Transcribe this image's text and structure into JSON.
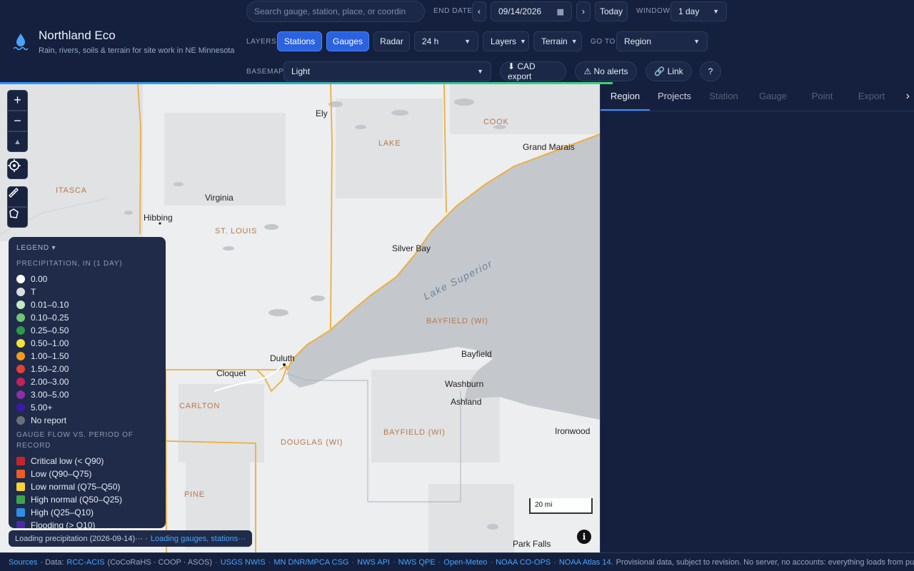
{
  "brand": {
    "title": "Northland Eco",
    "subtitle": "Rain, rivers, soils & terrain for site work in NE Minnesota"
  },
  "search": {
    "placeholder": "Search gauge, station, place, or coordinates"
  },
  "end_date": {
    "label": "END DATE",
    "prev": "‹",
    "value": "09/14/2026",
    "next": "›",
    "today": "Today"
  },
  "window": {
    "label": "WINDOW",
    "value": "1 day"
  },
  "layers": {
    "label": "LAYERS",
    "stations": "Stations",
    "gauges": "Gauges",
    "radar": "Radar",
    "period": "24 h",
    "layers_menu": "Layers",
    "terrain_menu": "Terrain"
  },
  "goto": {
    "label": "GO TO",
    "value": "Region"
  },
  "basemap": {
    "label": "BASEMAP",
    "value": "Light"
  },
  "actions": {
    "cad_export": "⬇ CAD export",
    "alerts": "⚠ No alerts",
    "link": "🔗 Link",
    "help": "?"
  },
  "progress": 0.67,
  "map_controls": {
    "zoom_in": "+",
    "zoom_out": "−",
    "compass": "▲"
  },
  "places": {
    "ely": "Ely",
    "grand_marais": "Grand Marais",
    "virginia": "Virginia",
    "hibbing": "Hibbing",
    "silver_bay": "Silver Bay",
    "duluth": "Duluth",
    "cloquet": "Cloquet",
    "bayfield": "Bayfield",
    "washburn": "Washburn",
    "ashland": "Ashland",
    "ironwood": "Ironwood",
    "park_falls": "Park Falls"
  },
  "counties": {
    "lake": "LAKE",
    "cook": "COOK",
    "itasca": "ITASCA",
    "st_louis": "ST. LOUIS",
    "bayfield_wi_north": "BAYFIELD (WI)",
    "carlton": "CARLTON",
    "douglas": "DOUGLAS (WI)",
    "bayfield_wi_south": "BAYFIELD (WI)",
    "pine": "PINE"
  },
  "lake_label": "Lake Superior",
  "legend": {
    "title": "LEGEND ▾",
    "precip_title": "PRECIPITATION, IN (1 DAY)",
    "precip": [
      {
        "label": "0.00",
        "color": "#ffffff"
      },
      {
        "label": "T",
        "color": "#d9dde3"
      },
      {
        "label": "0.01–0.10",
        "color": "#c4e8c0"
      },
      {
        "label": "0.10–0.25",
        "color": "#74c476"
      },
      {
        "label": "0.25–0.50",
        "color": "#2e9a44"
      },
      {
        "label": "0.50–1.00",
        "color": "#f4e23a"
      },
      {
        "label": "1.00–1.50",
        "color": "#f59a1d"
      },
      {
        "label": "1.50–2.00",
        "color": "#e3403a"
      },
      {
        "label": "2.00–3.00",
        "color": "#c81f5a"
      },
      {
        "label": "3.00–5.00",
        "color": "#8e2ea4"
      },
      {
        "label": "5.00+",
        "color": "#3b1aa8"
      },
      {
        "label": "No report",
        "color": "#6b6f78"
      }
    ],
    "flow_title": "GAUGE FLOW VS. PERIOD OF RECORD",
    "flow": [
      {
        "label": "Critical low (< Q90)",
        "color": "#c1272d"
      },
      {
        "label": "Low (Q90–Q75)",
        "color": "#f05a24"
      },
      {
        "label": "Low normal (Q75–Q50)",
        "color": "#f7d239"
      },
      {
        "label": "High normal (Q50–Q25)",
        "color": "#3fa34d"
      },
      {
        "label": "High (Q25–Q10)",
        "color": "#2f8fe8"
      },
      {
        "label": "Flooding (> Q10)",
        "color": "#4b2aa8"
      }
    ]
  },
  "loading": {
    "precip": "Loading precipitation (2026-09-14)··· ·",
    "gauges": "Loading gauges, stations···"
  },
  "scale": "20 mi",
  "info": "i",
  "tabs": [
    {
      "label": "Region",
      "state": "active"
    },
    {
      "label": "Projects",
      "state": "enabled"
    },
    {
      "label": "Station",
      "state": "disabled"
    },
    {
      "label": "Gauge",
      "state": "disabled"
    },
    {
      "label": "Point",
      "state": "disabled"
    },
    {
      "label": "Export",
      "state": "disabled"
    }
  ],
  "tab_next": "›",
  "footer": {
    "sources": "Sources",
    "data_prefix": "· Data:",
    "rcc": "RCC-ACIS",
    "rcc_note": "(CoCoRaHS · COOP · ASOS)",
    "usgs": "USGS NWIS",
    "mndnr": "MN DNR/MPCA CSG",
    "nws_api": "NWS API",
    "nws_qpe": "NWS QPE",
    "open_meteo": "Open-Meteo",
    "noaa_coops": "NOAA CO-OPS",
    "atlas": "NOAA Atlas 14.",
    "note": "Provisional data, subject to revision. No server, no accounts: everything loads from public APIs in your browser."
  }
}
